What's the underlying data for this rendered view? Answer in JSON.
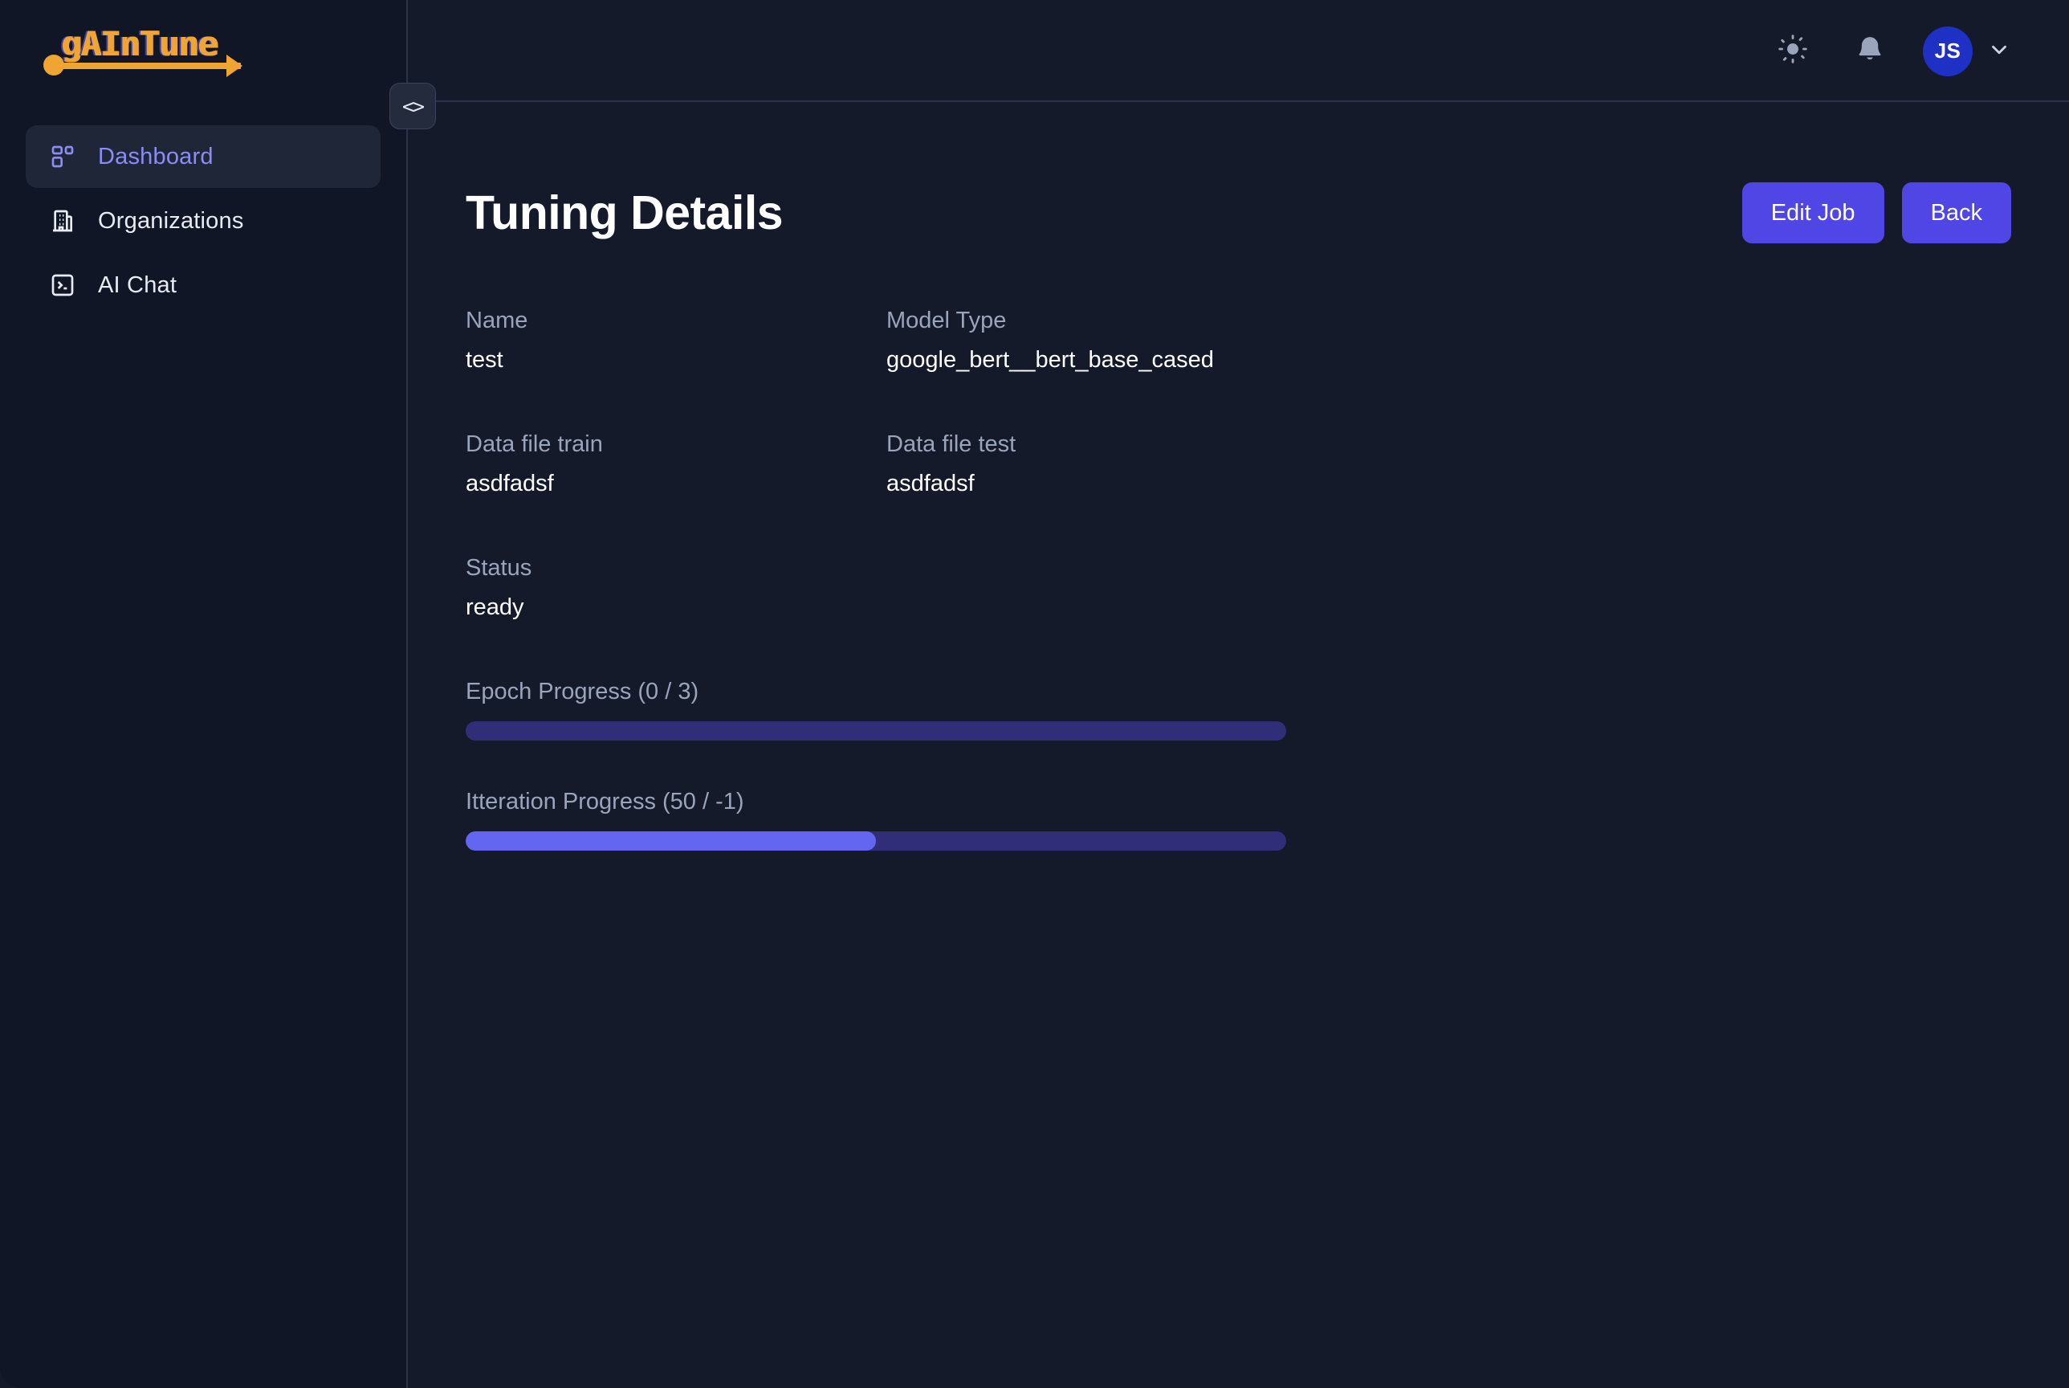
{
  "app": {
    "logo_text": "gAInTune",
    "logo_accent_color": "#f0a431",
    "accent_color": "#4f46e5",
    "active_nav_color": "#8b8df5"
  },
  "sidebar": {
    "items": [
      {
        "label": "Dashboard",
        "icon": "dashboard-icon",
        "active": true
      },
      {
        "label": "Organizations",
        "icon": "building-icon",
        "active": false
      },
      {
        "label": "AI Chat",
        "icon": "terminal-icon",
        "active": false
      }
    ],
    "collapse_toggle_glyph": "<>"
  },
  "topbar": {
    "theme_toggle_icon": "sun-icon",
    "notifications_icon": "bell-icon",
    "avatar_initials": "JS",
    "user_chevron_icon": "chevron-down-icon"
  },
  "page": {
    "title": "Tuning Details",
    "actions": [
      {
        "label": "Edit Job"
      },
      {
        "label": "Back"
      }
    ]
  },
  "details": {
    "fields": [
      {
        "label": "Name",
        "value": "test"
      },
      {
        "label": "Model Type",
        "value": "google_bert__bert_base_cased"
      },
      {
        "label": "Data file train",
        "value": "asdfadsf"
      },
      {
        "label": "Data file test",
        "value": "asdfadsf"
      },
      {
        "label": "Status",
        "value": "ready"
      }
    ]
  },
  "progress": [
    {
      "label": "Epoch Progress (0 / 3)",
      "current": 0,
      "total": 3,
      "percent": 0,
      "fill_color": "#6366f1",
      "track_color": "#312e79"
    },
    {
      "label": "Itteration Progress (50 / -1)",
      "current": 50,
      "total": -1,
      "percent": 50,
      "fill_color": "#6366f1",
      "track_color": "#312e79"
    }
  ]
}
